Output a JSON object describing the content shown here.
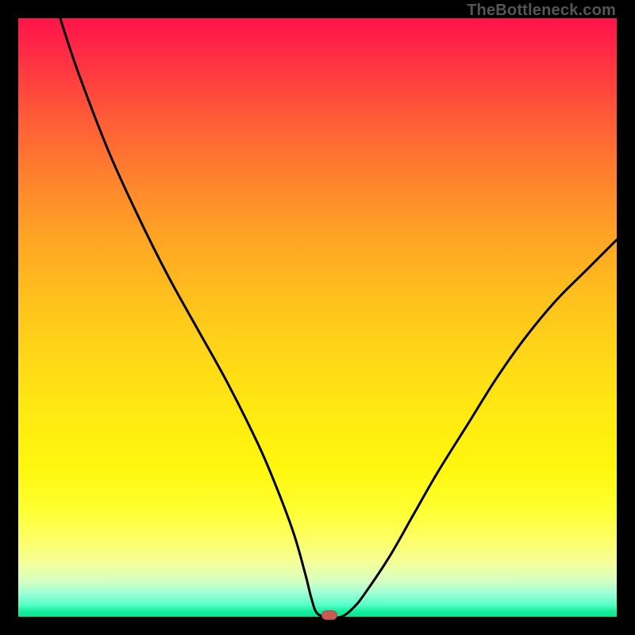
{
  "watermark": "TheBottleneck.com",
  "colors": {
    "curve_stroke": "#000000",
    "marker_fill": "#c85b55"
  },
  "chart_data": {
    "type": "line",
    "title": "",
    "xlabel": "",
    "ylabel": "",
    "xlim": [
      0,
      100
    ],
    "ylim": [
      0,
      100
    ],
    "grid": false,
    "legend": false,
    "notes": "V-shaped bottleneck curve on rainbow gradient. Minimum (0%) at x≈52; curve rises steeply on both sides. Left branch hits 100% at x≈7; right branch reaches ≈63% at x=100. Small flat segment along y=0 from ≈x=49 to ≈x=54.",
    "marker": {
      "x": 52,
      "y": 0
    },
    "series": [
      {
        "name": "bottleneck-curve",
        "x": [
          7,
          10,
          15,
          20,
          25,
          30,
          35,
          40,
          43,
          46,
          48,
          49,
          50,
          52,
          54,
          56,
          58,
          62,
          66,
          70,
          75,
          80,
          85,
          90,
          95,
          100
        ],
        "values": [
          100,
          91,
          78,
          67,
          57,
          48,
          39,
          29,
          22,
          14,
          7,
          3,
          0.5,
          0,
          0,
          1.5,
          4,
          10,
          17,
          24,
          32,
          40,
          47,
          53,
          58,
          63
        ]
      }
    ]
  }
}
